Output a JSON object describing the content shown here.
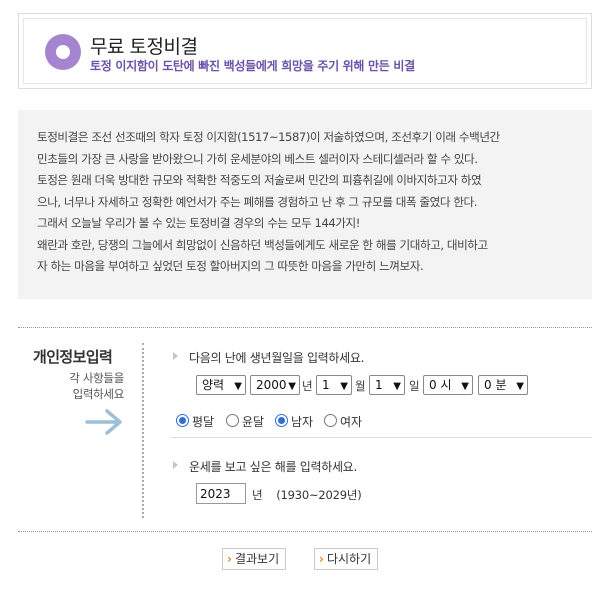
{
  "header": {
    "title": "무료 토정비결",
    "subtitle": "토정 이지함이 도탄에 빠진 백성들에게 희망을 주기 위해 만든 비결",
    "icon": "circle-icon",
    "accent_color": "#a585cf"
  },
  "intro": {
    "lines": [
      "토정비결은 조선 선조때의 학자 토정 이지함(1517~1587)이 저술하였으며, 조선후기 이래 수백년간",
      "민초들의 가장 큰 사랑을 받아왔으니 가히 운세분야의 베스트 셀러이자 스테디셀러라 할 수 있다.",
      "토정은 원래 더욱 방대한 규모와 적확한 적중도의 저술로써 민간의 피흉취길에 이바지하고자 하였",
      "으나, 너무나 자세하고 정확한 예언서가 주는 폐해를 경험하고 난 후 그 규모를 대폭 줄였다 한다.",
      "그래서 오늘날 우리가 볼 수 있는 토정비결 경우의 수는 모두 144가지!",
      "왜란과 호란, 당쟁의 그늘에서 희망없이 신음하던 백성들에게도 새로운 한 해를 기대하고, 대비하고",
      "자 하는 마음을 부여하고 싶었던 토정 할아버지의 그 따뜻한 마음을 가만히 느껴보자."
    ]
  },
  "form": {
    "section_title": "개인정보입력",
    "section_desc_line1": "각 사항들을",
    "section_desc_line2": "입력하세요",
    "birth_instruction": "다음의 난에 생년월일을 입력하세요.",
    "calendar_type": "양력",
    "year": "2000",
    "year_unit": "년",
    "month": "1",
    "month_unit": "월",
    "day": "1",
    "day_unit": "일",
    "hour": "0 시",
    "minute": "0 분",
    "radio_normal_label": "평달",
    "radio_leap_label": "윤달",
    "radio_male_label": "남자",
    "radio_female_label": "여자",
    "target_instruction": "운세를 보고 싶은 해를 입력하세요.",
    "target_year": "2023",
    "target_year_unit": "년",
    "target_year_range": "(1930~2029년)"
  },
  "buttons": {
    "result_label": "결과보기",
    "reset_label": "다시하기"
  },
  "colors": {
    "radio_selected": "#2b6fd6",
    "arrow": "#9cc0d6",
    "button_chevron": "#e08a1e"
  }
}
